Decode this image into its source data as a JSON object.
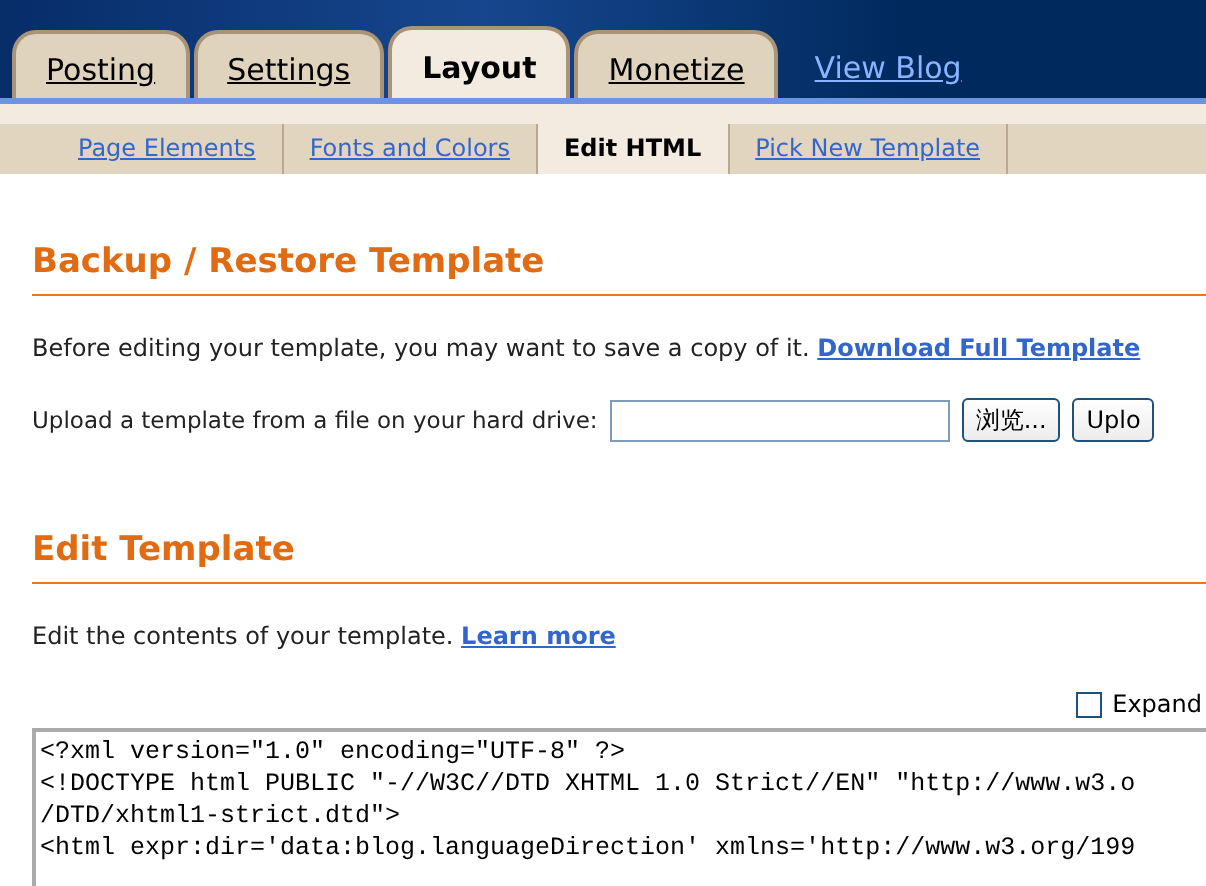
{
  "tabs": [
    {
      "label": "Posting",
      "selected": false
    },
    {
      "label": "Settings",
      "selected": false
    },
    {
      "label": "Layout",
      "selected": true
    },
    {
      "label": "Monetize",
      "selected": false
    }
  ],
  "view_blog": "View Blog",
  "subtabs": [
    {
      "label": "Page Elements",
      "selected": false
    },
    {
      "label": "Fonts and Colors",
      "selected": false
    },
    {
      "label": "Edit HTML",
      "selected": true
    },
    {
      "label": "Pick New Template",
      "selected": false
    }
  ],
  "backup": {
    "title": "Backup / Restore Template",
    "text": "Before editing your template, you may want to save a copy of it.",
    "link": "Download Full Template",
    "upload_label": "Upload a template from a file on your hard drive:",
    "browse_button": "浏览...",
    "upload_button": "Uplo"
  },
  "edit": {
    "title": "Edit Template",
    "text": "Edit the contents of your template.",
    "link": "Learn more",
    "expand": {
      "label": "Expand",
      "checked": false
    },
    "code_lines": [
      "<?xml version=\"1.0\" encoding=\"UTF-8\" ?>",
      "<!DOCTYPE html PUBLIC \"-//W3C//DTD XHTML 1.0 Strict//EN\" \"http://www.w3.o",
      "/DTD/xhtml1-strict.dtd\">",
      "<html expr:dir='data:blog.languageDirection' xmlns='http://www.w3.org/199"
    ]
  }
}
